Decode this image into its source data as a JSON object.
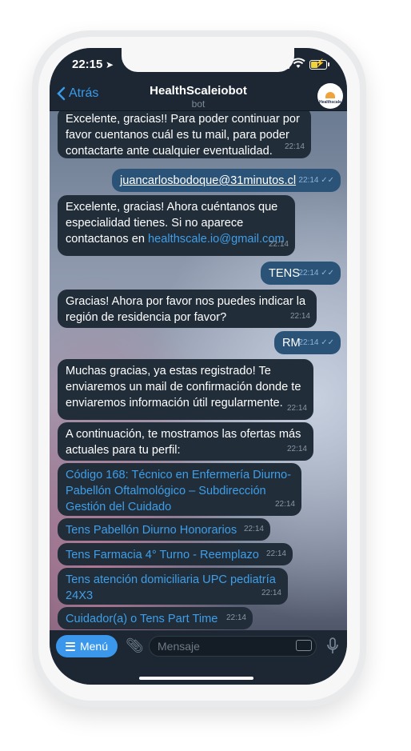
{
  "status": {
    "time": "22:15"
  },
  "nav": {
    "back_label": "Atrás",
    "title": "HealthScaleiobot",
    "subtitle": "bot",
    "avatar_text": "Healthscale"
  },
  "messages": [
    {
      "dir": "in",
      "text": "Excelente, gracias!! Para poder continuar por favor cuentanos cuál es tu mail, para poder contactarte ante cualquier eventualidad.",
      "time": "22:14"
    },
    {
      "dir": "out",
      "text": "juancarlosbodoque@31minutos.cl",
      "time": "22:14"
    },
    {
      "dir": "in",
      "text_before": "Excelente, gracias! Ahora cuéntanos que especialidad tienes. Si no aparece contactanos en ",
      "link": "healthscale.io@gmail.com",
      "time": "22:14"
    },
    {
      "dir": "out",
      "text": "TENS",
      "time": "22:14"
    },
    {
      "dir": "in",
      "text": "Gracias! Ahora por favor nos puedes indicar la región de residencia por favor?",
      "time": "22:14"
    },
    {
      "dir": "out",
      "text": "RM",
      "time": "22:14"
    },
    {
      "dir": "in",
      "text": "Muchas gracias, ya estas registrado! Te enviaremos un mail de confirmación donde te enviaremos información útil regularmente.",
      "time": "22:14"
    },
    {
      "dir": "in",
      "text": "A continuación, te mostramos las ofertas más actuales para tu perfil:",
      "time": "22:14"
    },
    {
      "dir": "in",
      "link": "Código 168: Técnico en Enfermería Diurno-Pabellón Oftalmológico – Subdirección Gestión del Cuidado",
      "time": "22:14"
    },
    {
      "dir": "in",
      "link": "Tens Pabellón Diurno Honorarios",
      "time": "22:14"
    },
    {
      "dir": "in",
      "link": "Tens Farmacia 4° Turno - Reemplazo",
      "time": "22:14"
    },
    {
      "dir": "in",
      "link": "Tens atención domiciliaria  UPC pediatría 24X3",
      "time": "22:14"
    },
    {
      "dir": "in",
      "link": "Cuidador(a) o Tens Part Time",
      "time": "22:14"
    }
  ],
  "input": {
    "menu_label": "Menú",
    "placeholder": "Mensaje"
  }
}
